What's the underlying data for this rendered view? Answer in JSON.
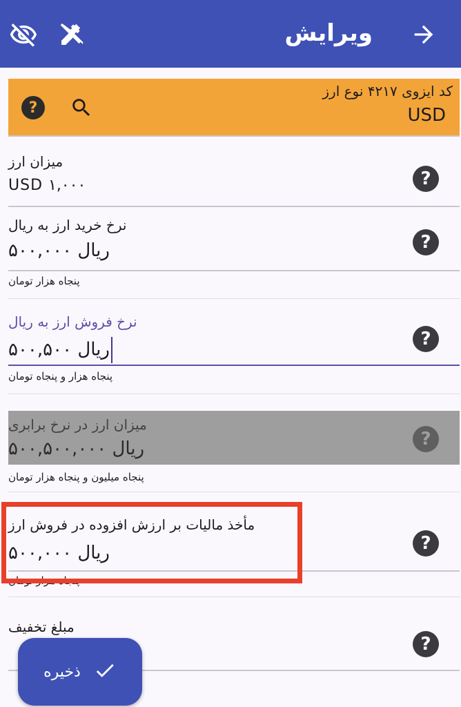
{
  "appbar": {
    "title": "ویرایش",
    "back_icon": "arrow-forward-icon",
    "visibility_icon": "visibility-off-icon",
    "tools_icon": "tools-icon"
  },
  "currency_code": {
    "label": "کد ایزوی ۴۲۱۷ نوع ارز",
    "value": "USD"
  },
  "fields": [
    {
      "label": "میزان ارز",
      "value": "USD ۱,۰۰۰",
      "hint": ""
    },
    {
      "label": "نرخ خرید ارز به ریال",
      "value": "۵۰۰,۰۰۰ ریال",
      "hint": "پنجاه هزار تومان"
    },
    {
      "label": "نرخ فروش ارز به ریال",
      "value": "۵۰۰,۵۰۰ ریال",
      "hint": "پنجاه هزار و پنجاه تومان"
    },
    {
      "label": "میزان ارز در نرخ برابری",
      "value": "۵۰۰,۵۰۰,۰۰۰ ریال",
      "hint": "پنجاه میلیون و پنجاه هزار تومان"
    },
    {
      "label": "مأخذ مالیات بر ارزش افزوده در فروش ارز",
      "value": "۵۰۰,۰۰۰ ریال",
      "hint": "پنجاه هزار تومان"
    },
    {
      "label": "مبلغ تخفیف",
      "value": "",
      "hint": ""
    }
  ],
  "help_glyph": "?",
  "fab": {
    "label": "ذخیره"
  },
  "colors": {
    "appbar": "#3f51b5",
    "orange": "#f3a438",
    "focus": "#6a5acd",
    "highlight": "#e8402a",
    "disabled": "#9e9e9e"
  }
}
